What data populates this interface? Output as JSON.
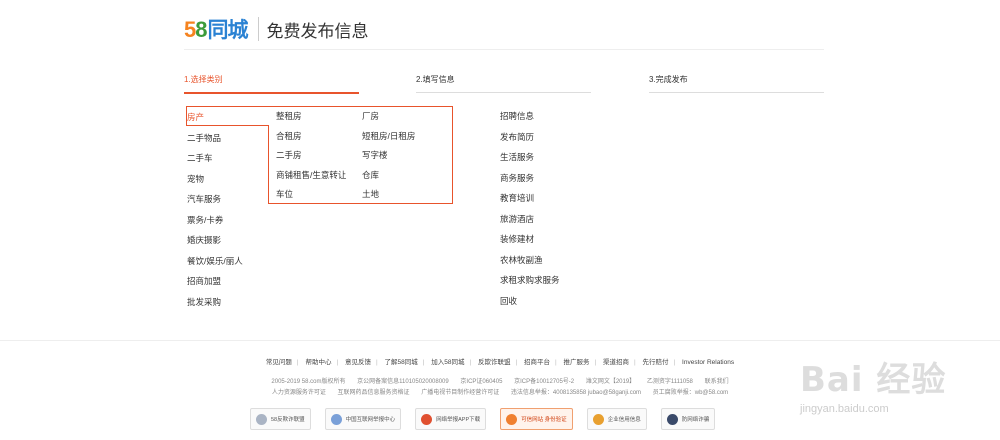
{
  "header": {
    "logo_digit_5": "5",
    "logo_digit_8": "8",
    "logo_text": "同城",
    "title": "免费发布信息"
  },
  "steps": [
    {
      "label": "1.选择类别",
      "active": true
    },
    {
      "label": "2.填写信息",
      "active": false
    },
    {
      "label": "3.完成发布",
      "active": false
    }
  ],
  "categories_left": [
    "房产",
    "二手物品",
    "二手车",
    "宠物",
    "汽车服务",
    "票务/卡券",
    "婚庆摄影",
    "餐饮/娱乐/丽人",
    "招商加盟",
    "批发采购"
  ],
  "selected_category": "房产",
  "subcategories": [
    "整租房",
    "厂房",
    "合租房",
    "短租房/日租房",
    "二手房",
    "写字楼",
    "商铺租售/生意转让",
    "仓库",
    "车位",
    "土地"
  ],
  "categories_right": [
    "招聘信息",
    "发布简历",
    "生活服务",
    "商务服务",
    "教育培训",
    "旅游酒店",
    "装修建材",
    "农林牧副渔",
    "求租求购求服务",
    "回收"
  ],
  "footer": {
    "links": [
      "常见问题",
      "帮助中心",
      "意见反馈",
      "了解58同城",
      "加入58同城",
      "反欺诈联盟",
      "招商平台",
      "推广服务",
      "渠道招商",
      "先行赔付",
      "Investor Relations"
    ],
    "legal_line1": [
      "2005-2019 58.com版权所有",
      "京公网备案信息110105020008009",
      "京ICP证060405",
      "京ICP备10012705号-2",
      "潍文网文【2019】",
      "乙测资字1111058",
      "联系我们"
    ],
    "legal_line2": [
      "人力资源服务许可证",
      "互联网药品信息服务资格证",
      "广播电视节目制作经营许可证",
      "违法信息举报：4008135858 jubao@58ganji.com",
      "员工腐败举报：wb@58.com"
    ],
    "badges": [
      "58反欺诈联盟",
      "中国互联网举报中心",
      "网络举报APP下载",
      "可信网站 身份验证",
      "企业信用信息",
      "防网络诈骗"
    ]
  },
  "watermark": {
    "text": "Bai 经验",
    "url": "jingyan.baidu.com"
  },
  "colors": {
    "accent": "#e8542c",
    "logo_orange": "#f5831f",
    "logo_green": "#3b9b3b",
    "logo_blue": "#2a82d3"
  }
}
